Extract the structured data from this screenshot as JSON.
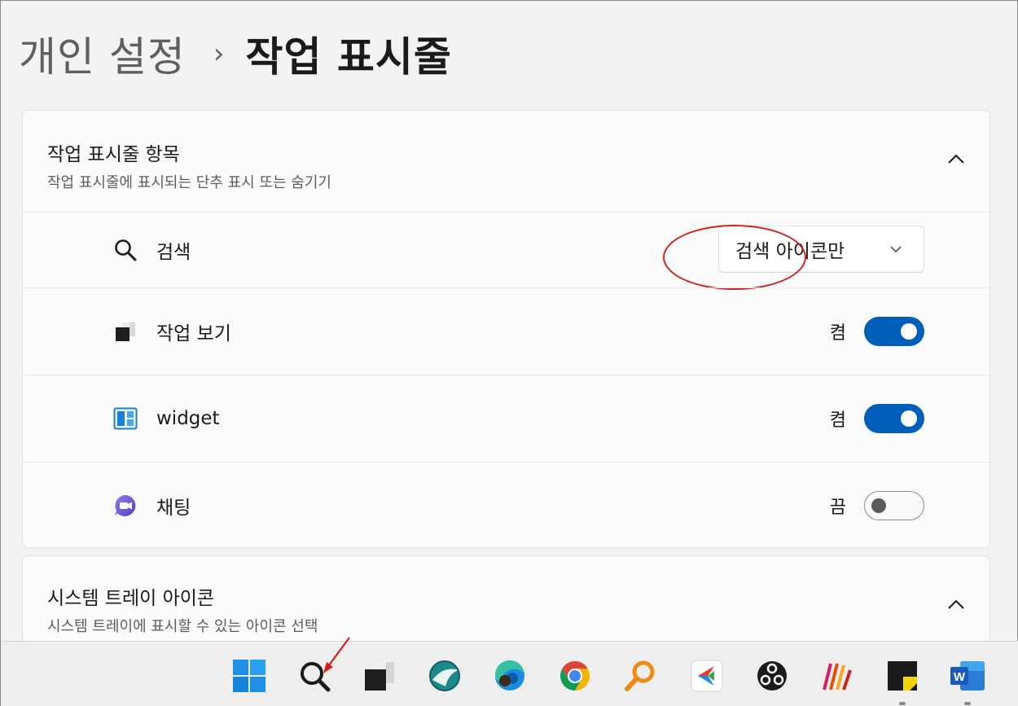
{
  "breadcrumb": {
    "parent": "개인 설정",
    "separator": "›",
    "current": "작업 표시줄"
  },
  "taskbar_items_section": {
    "title": "작업 표시줄 항목",
    "subtitle": "작업 표시줄에 표시되는 단추 표시 또는 숨기기",
    "collapse_icon": "chevron-up-icon",
    "rows": [
      {
        "label": "검색",
        "icon": "search-icon",
        "control": "dropdown",
        "value": "검색 아이콘만"
      },
      {
        "label": "작업 보기",
        "icon": "task-view-icon",
        "control": "toggle",
        "state": "켬",
        "on": true
      },
      {
        "label": "widget",
        "icon": "widgets-icon",
        "control": "toggle",
        "state": "켬",
        "on": true
      },
      {
        "label": "채팅",
        "icon": "chat-icon",
        "control": "toggle",
        "state": "끔",
        "on": false
      }
    ]
  },
  "system_tray_section": {
    "title": "시스템 트레이 아이콘",
    "subtitle": "시스템 트레이에 표시할 수 있는 아이콘 선택",
    "collapse_icon": "chevron-up-icon"
  },
  "taskbar": {
    "items": [
      "windows-start-icon",
      "search-icon",
      "task-view-icon",
      "app-icon",
      "edge-icon",
      "chrome-icon",
      "magnifier-app-icon",
      "app-icon",
      "obs-icon",
      "app-icon",
      "sticky-notes-icon",
      "word-icon"
    ]
  },
  "colors": {
    "accent": "#005fb8",
    "annotation": "#d41f1f"
  }
}
